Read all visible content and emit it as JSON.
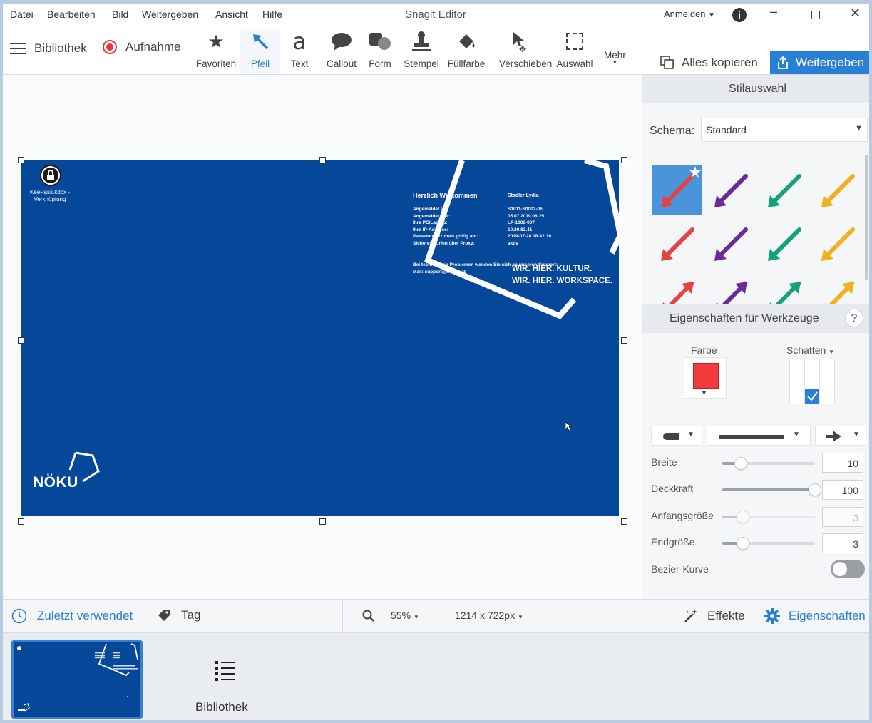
{
  "menu": {
    "items": [
      "Datei",
      "Bearbeiten",
      "Bild",
      "Weitergeben",
      "Ansicht",
      "Hilfe"
    ],
    "title": "Snagit Editor",
    "signin": "Anmelden"
  },
  "toolbar": {
    "library": "Bibliothek",
    "capture": "Aufnahme",
    "tools": [
      "Favoriten",
      "Pfeil",
      "Text",
      "Callout",
      "Form",
      "Stempel",
      "Füllfarbe",
      "Verschieben",
      "Auswahl"
    ],
    "text_tool_glyph": "a",
    "more": "Mehr",
    "copy_all": "Alles kopieren",
    "share": "Weitergeben"
  },
  "screenshot": {
    "icon_label_1": "KeePass.kdbx -",
    "icon_label_2": "Verknüpfung",
    "welcome_left": "Herzlich Willkommen",
    "welcome_right": "Stadler Lydia",
    "info_labels": [
      "Angemeldet an:",
      "Angemeldet seit:",
      "Ihre PC/Laptop:",
      "Ihre IP-Adresse:",
      "Passwort letztmals gültig am:",
      "Sicheres surfen über Proxy:"
    ],
    "info_values": [
      "S1011-S0002-06",
      "05.07.2019 08:25",
      "LP-1006-007",
      "10.20.83.41",
      "2019-07-28 08:42:10",
      "aktiv"
    ],
    "support_1": "Bei technischen Problemen wenden Sie sich an unseren Support:",
    "support_2": "Mail: support@noeku.at",
    "slogan_1": "WIR. HIER. KULTUR.",
    "slogan_2": "WIR. HIER. WORKSPACE.",
    "logo": "NÖKU"
  },
  "panel": {
    "style_title": "Stilauswahl",
    "schema_label": "Schema:",
    "schema_value": "Standard",
    "props_title": "Eigenschaften für Werkzeuge",
    "help": "?",
    "color_label": "Farbe",
    "shadow_label": "Schatten",
    "color_value": "#f23c3c",
    "props": [
      {
        "label": "Breite",
        "value": "10",
        "level": 0.2,
        "disabled": false
      },
      {
        "label": "Deckkraft",
        "value": "100",
        "level": 1.0,
        "disabled": false
      },
      {
        "label": "Anfangsgröße",
        "value": "3",
        "level": 0.22,
        "disabled": true
      },
      {
        "label": "Endgröße",
        "value": "3",
        "level": 0.22,
        "disabled": false
      }
    ],
    "bezier_label": "Bezier-Kurve",
    "arrow_colors": [
      "#e8423f",
      "#6b2a9a",
      "#13a37a",
      "#f2b01e"
    ]
  },
  "bottombar": {
    "recent": "Zuletzt verwendet",
    "tag": "Tag",
    "zoom": "55%",
    "size": "1214 x 722px",
    "effects": "Effekte",
    "properties": "Eigenschaften"
  },
  "tray": {
    "library": "Bibliothek"
  }
}
